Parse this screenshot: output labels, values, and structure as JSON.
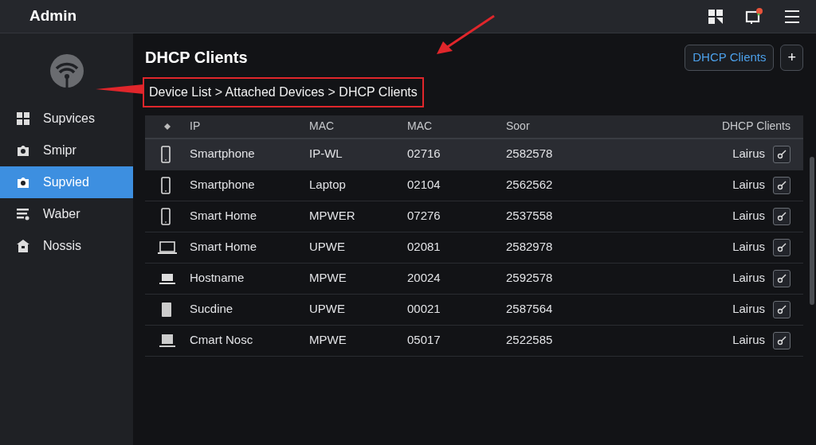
{
  "app_bar": {
    "title": "Admin",
    "notification": true
  },
  "sidebar": {
    "items": [
      {
        "label": "Supvices",
        "selected": false
      },
      {
        "label": "Smipr",
        "selected": false
      },
      {
        "label": "Supvied",
        "selected": true
      },
      {
        "label": "Waber",
        "selected": false
      },
      {
        "label": "Nossis",
        "selected": false
      }
    ]
  },
  "page": {
    "title": "DHCP Clients",
    "breadcrumb": "Device List > Attached Devices > DHCP Clients",
    "action_button": "DHCP Clients",
    "add_button": "+"
  },
  "table": {
    "columns": [
      "IP",
      "MAC",
      "MAC",
      "Soor",
      "DHCP Clients"
    ],
    "rows": [
      {
        "kind": "phone",
        "cells": [
          "Smartphone",
          "IP-WL",
          "02716",
          "2582578",
          "Lairus"
        ],
        "selected": true
      },
      {
        "kind": "phone",
        "cells": [
          "Smartphone",
          "Laptop",
          "02104",
          "2562562",
          "Lairus"
        ],
        "selected": false
      },
      {
        "kind": "phone",
        "cells": [
          "Smart Home",
          "MPWER",
          "07276",
          "2537558",
          "Lairus"
        ],
        "selected": false
      },
      {
        "kind": "laptop",
        "cells": [
          "Smart Home",
          "UPWE",
          "02081",
          "2582978",
          "Lairus"
        ],
        "selected": false
      },
      {
        "kind": "desktop",
        "cells": [
          "Hostname",
          "MPWE",
          "20024",
          "2592578",
          "Lairus"
        ],
        "selected": false
      },
      {
        "kind": "tablet",
        "cells": [
          "Sucdine",
          "UPWE",
          "00021",
          "2587564",
          "Lairus"
        ],
        "selected": false
      },
      {
        "kind": "monitor",
        "cells": [
          "Cmart Nosc",
          "MPWE",
          "05017",
          "2522585",
          "Lairus"
        ],
        "selected": false
      }
    ]
  }
}
